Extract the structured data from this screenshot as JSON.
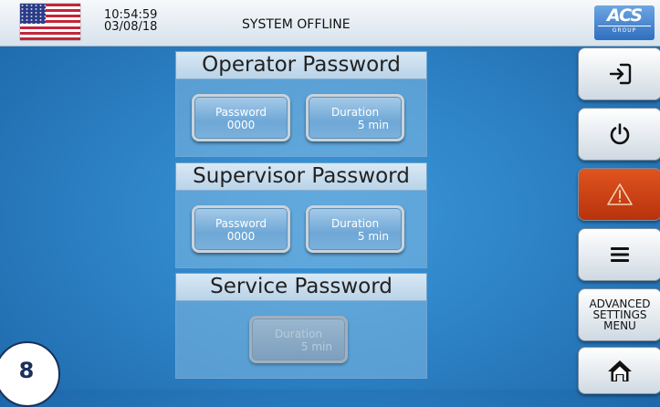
{
  "header": {
    "time": "10:54:59",
    "date": "03/08/18",
    "status": "SYSTEM OFFLINE",
    "logo": {
      "text": "ACS",
      "subtext": "GROUP"
    }
  },
  "panels": [
    {
      "title": "Operator Password",
      "password": {
        "label": "Password",
        "value": "0000"
      },
      "duration": {
        "label": "Duration",
        "value": "5  min"
      }
    },
    {
      "title": "Supervisor Password",
      "password": {
        "label": "Password",
        "value": "0000"
      },
      "duration": {
        "label": "Duration",
        "value": "5  min"
      }
    },
    {
      "title": "Service Password",
      "duration": {
        "label": "Duration",
        "value": "5  min",
        "enabled": false
      }
    }
  ],
  "sidebar": {
    "buttons": [
      {
        "icon": "login-icon"
      },
      {
        "icon": "power-icon"
      },
      {
        "icon": "alarm-warning-icon",
        "color": "#c93d12"
      },
      {
        "icon": "menu-icon"
      },
      {
        "label_lines": [
          "ADVANCED",
          "SETTINGS",
          "MENU"
        ]
      },
      {
        "icon": "home-icon"
      }
    ]
  },
  "step_badge": "8",
  "colors": {
    "background": "#2d83c6",
    "alarm": "#c93d12"
  }
}
